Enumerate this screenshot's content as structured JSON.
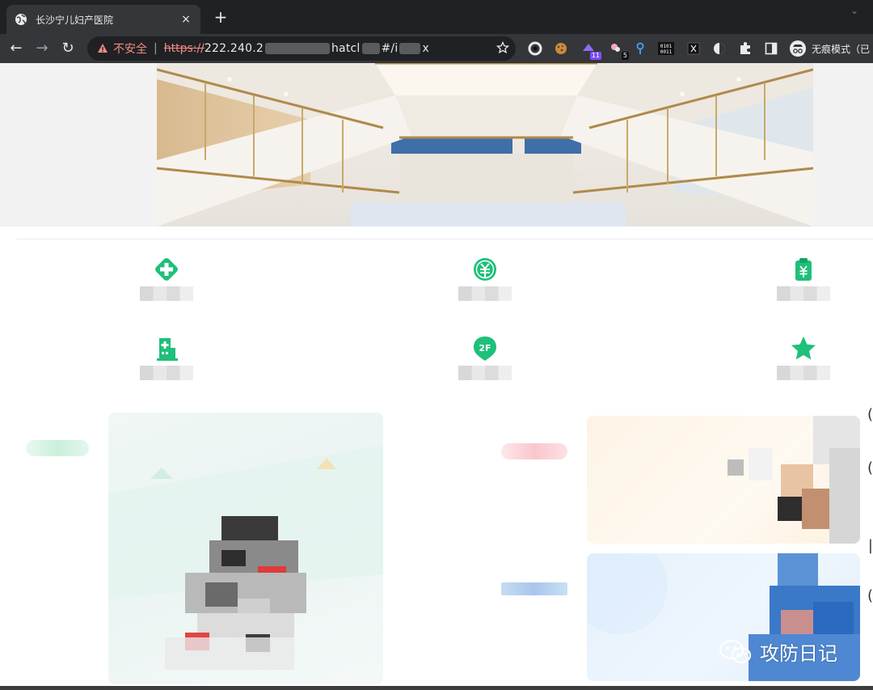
{
  "browser": {
    "tab_title": "长沙宁儿妇产医院",
    "tab_close": "×",
    "new_tab": "+",
    "tab_menu": "⌄",
    "nav_back": "←",
    "nav_forward": "→",
    "nav_reload": "↻",
    "security_label": "不安全",
    "separator": "|",
    "url_scheme": "https://",
    "url_host": "222.240.2",
    "url_mid": "hatcl",
    "url_hash": "#/i",
    "url_tail": "x",
    "extension_badge_1": "11",
    "extension_badge_2": "5",
    "incognito_label": "无痕模式（已",
    "icons": [
      "globe-icon",
      "warning-icon",
      "star-icon",
      "puzzle-icon",
      "sidebar-icon",
      "incognito-icon"
    ]
  },
  "services": {
    "row1": [
      {
        "label": "",
        "icon": "medical-cross-icon"
      },
      {
        "label": "",
        "icon": "yuan-coin-icon"
      },
      {
        "label": "",
        "icon": "clipboard-yuan-icon"
      }
    ],
    "row2": [
      {
        "label": "",
        "icon": "hospital-building-icon"
      },
      {
        "label": "",
        "icon": "floor-2f-icon"
      },
      {
        "label": "",
        "icon": "star-favorite-icon"
      }
    ]
  },
  "watermark": {
    "text": "攻防日记",
    "icon": "wechat-icon"
  },
  "colors": {
    "accent_green": "#1ec07a",
    "chrome_dark": "#202124",
    "chrome_toolbar": "#35363a",
    "insecure_red": "#f28b82"
  }
}
